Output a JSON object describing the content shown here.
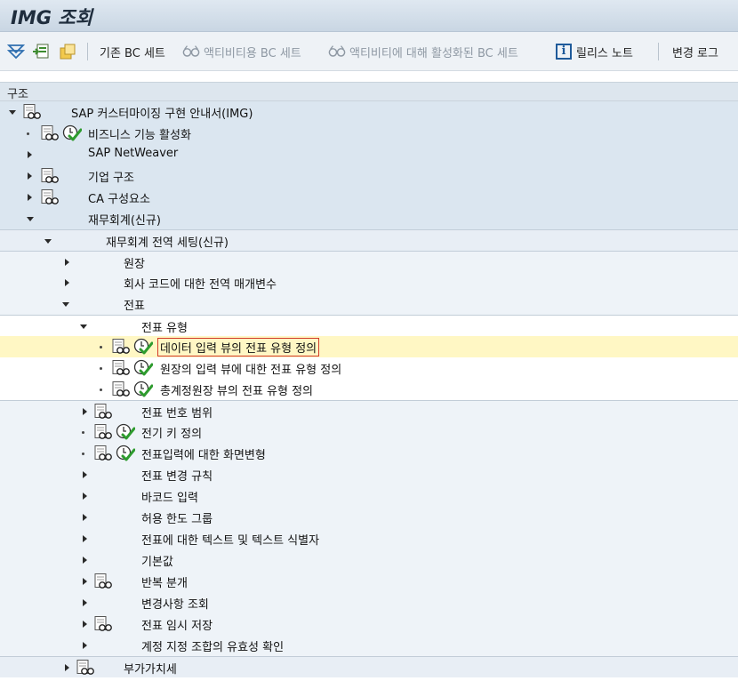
{
  "window": {
    "title": "IMG 조회"
  },
  "toolbar": {
    "existing_bc_sets": "기존 BC 세트",
    "activity_bc_sets": "액티비티용 BC 세트",
    "activated_bc_sets": "액티비티에 대해 활성화된 BC 세트",
    "release_notes": "릴리스 노트",
    "change_log": "변경 로그"
  },
  "structure": {
    "header": "구조",
    "nodes": [
      {
        "label": "SAP 커스터마이징 구현 안내서(IMG)"
      },
      {
        "label": "비즈니스 기능 활성화"
      },
      {
        "label": "SAP NetWeaver"
      },
      {
        "label": "기업 구조"
      },
      {
        "label": "CA 구성요소"
      },
      {
        "label": "재무회계(신규)"
      },
      {
        "label": "재무회계 전역 세팅(신규)"
      },
      {
        "label": "원장"
      },
      {
        "label": "회사 코드에 대한 전역 매개변수"
      },
      {
        "label": "전표"
      },
      {
        "label": "전표 유형"
      },
      {
        "label": "데이터 입력 뷰의 전표 유형 정의"
      },
      {
        "label": "원장의 입력 뷰에 대한 전표 유형 정의"
      },
      {
        "label": "총계정원장 뷰의 전표 유형 정의"
      },
      {
        "label": "전표 번호 범위"
      },
      {
        "label": "전기 키 정의"
      },
      {
        "label": "전표입력에 대한 화면변형"
      },
      {
        "label": "전표 변경 규칙"
      },
      {
        "label": "바코드 입력"
      },
      {
        "label": "허용 한도 그룹"
      },
      {
        "label": "전표에 대한 텍스트 및 텍스트 식별자"
      },
      {
        "label": "기본값"
      },
      {
        "label": "반복 분개"
      },
      {
        "label": "변경사항 조회"
      },
      {
        "label": "전표 임시 저장"
      },
      {
        "label": "계정 지정 조합의 유효성 확인"
      },
      {
        "label": "부가가치세"
      }
    ]
  }
}
